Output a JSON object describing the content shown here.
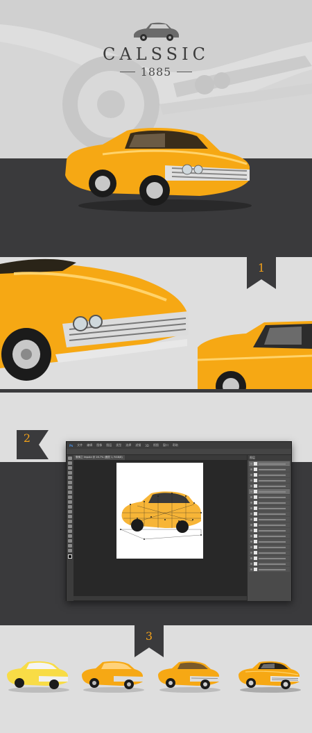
{
  "brand": {
    "title": "CALSSIC",
    "year": "1885"
  },
  "steps": [
    {
      "label": "1"
    },
    {
      "label": "2"
    },
    {
      "label": "3"
    }
  ],
  "photoshop": {
    "menus": [
      "Ps",
      "文件",
      "编辑",
      "图像",
      "图层",
      "类型",
      "选择",
      "滤镜",
      "3D",
      "视图",
      "窗口",
      "帮助"
    ],
    "tab": "雪佛兰 Impala @ 16.7% (图层 1, RGB/8)",
    "panel_title": "图层"
  },
  "colors": {
    "accent": "#f2a11a",
    "car_yellow": "#f6a814",
    "dark_band": "#3a3a3c",
    "light_band": "#dedede"
  }
}
